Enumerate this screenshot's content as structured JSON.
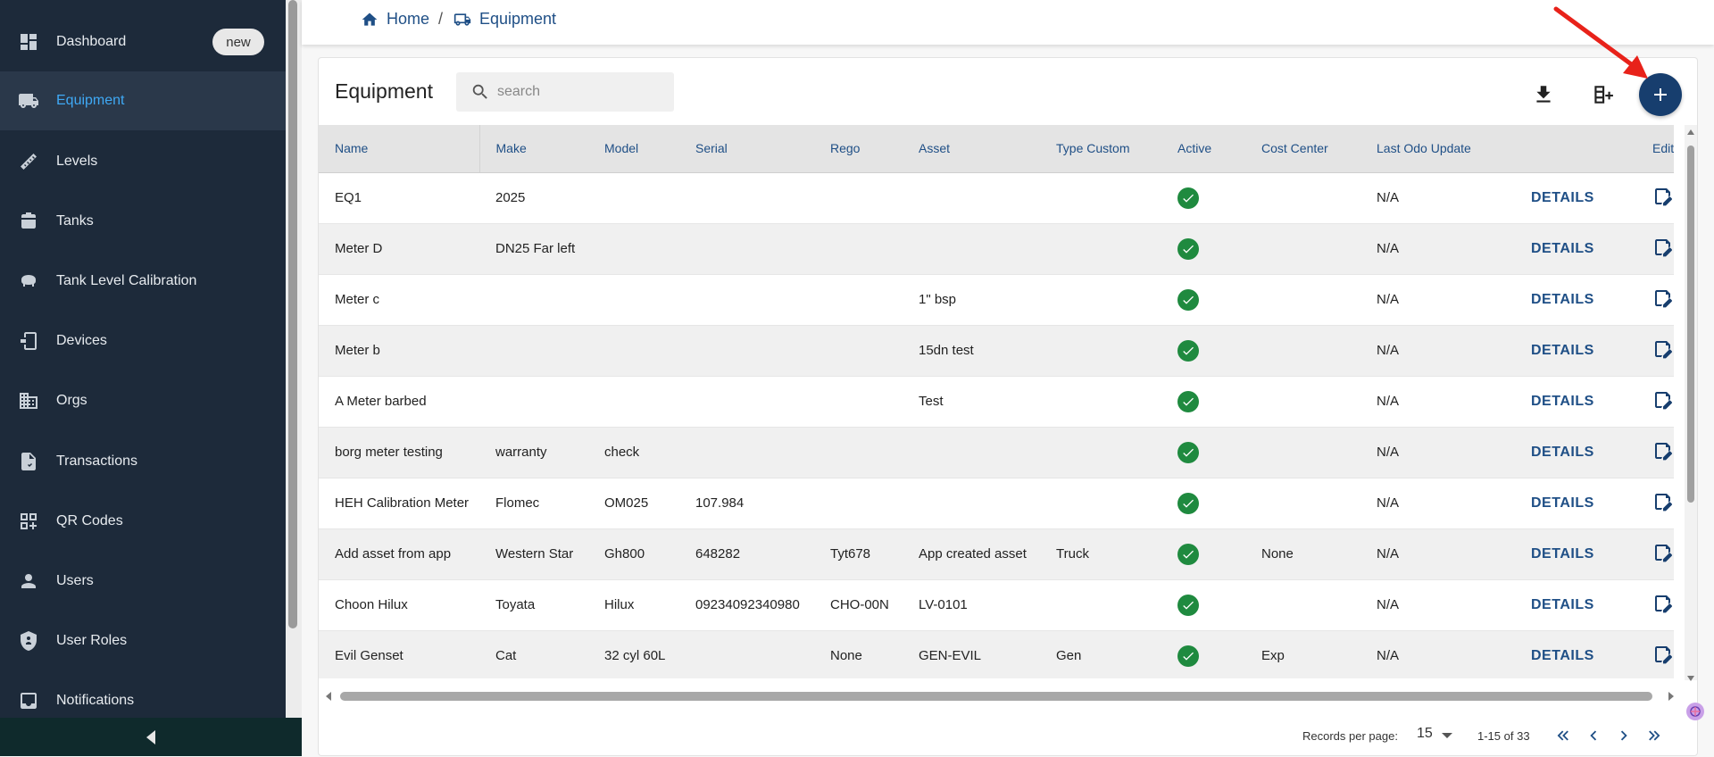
{
  "sidebar": {
    "items": [
      {
        "label": "Dashboard",
        "icon": "dashboard-icon",
        "badge": "new"
      },
      {
        "label": "Equipment",
        "icon": "truck-icon",
        "active": true
      },
      {
        "label": "Levels",
        "icon": "ruler-icon"
      },
      {
        "label": "Tanks",
        "icon": "tank-icon"
      },
      {
        "label": "Tank Level Calibration",
        "icon": "calibration-icon"
      },
      {
        "label": "Devices",
        "icon": "device-icon"
      },
      {
        "label": "Orgs",
        "icon": "building-icon"
      },
      {
        "label": "Transactions",
        "icon": "document-icon"
      },
      {
        "label": "QR Codes",
        "icon": "qr-code-icon"
      },
      {
        "label": "Users",
        "icon": "user-icon"
      },
      {
        "label": "User Roles",
        "icon": "shield-icon"
      },
      {
        "label": "Notifications",
        "icon": "inbox-icon"
      }
    ]
  },
  "breadcrumb": {
    "home": "Home",
    "separator": "/",
    "current": "Equipment"
  },
  "card": {
    "title": "Equipment",
    "search_placeholder": "search"
  },
  "table": {
    "columns": [
      "Name",
      "Make",
      "Model",
      "Serial",
      "Rego",
      "Asset",
      "Type Custom",
      "Active",
      "Cost Center",
      "Last Odo Update",
      "",
      "Edit"
    ],
    "details_label": "DETAILS",
    "rows": [
      {
        "name": "EQ1",
        "make": "2025",
        "model": "",
        "serial": "",
        "rego": "",
        "asset": "",
        "type_custom": "",
        "active": true,
        "cost_center": "",
        "last_odo": "N/A"
      },
      {
        "name": "Meter D",
        "make": "DN25 Far left",
        "model": "",
        "serial": "",
        "rego": "",
        "asset": "",
        "type_custom": "",
        "active": true,
        "cost_center": "",
        "last_odo": "N/A"
      },
      {
        "name": "Meter c",
        "make": "",
        "model": "",
        "serial": "",
        "rego": "",
        "asset": "1\" bsp",
        "type_custom": "",
        "active": true,
        "cost_center": "",
        "last_odo": "N/A"
      },
      {
        "name": "Meter b",
        "make": "",
        "model": "",
        "serial": "",
        "rego": "",
        "asset": "15dn test",
        "type_custom": "",
        "active": true,
        "cost_center": "",
        "last_odo": "N/A"
      },
      {
        "name": "A Meter barbed",
        "make": "",
        "model": "",
        "serial": "",
        "rego": "",
        "asset": "Test",
        "type_custom": "",
        "active": true,
        "cost_center": "",
        "last_odo": "N/A"
      },
      {
        "name": "borg meter testing",
        "make": "warranty",
        "model": "check",
        "serial": "",
        "rego": "",
        "asset": "",
        "type_custom": "",
        "active": true,
        "cost_center": "",
        "last_odo": "N/A"
      },
      {
        "name": "HEH Calibration Meter",
        "make": "Flomec",
        "model": "OM025",
        "serial": "107.984",
        "rego": "",
        "asset": "",
        "type_custom": "",
        "active": true,
        "cost_center": "",
        "last_odo": "N/A"
      },
      {
        "name": "Add asset from app",
        "make": "Western Star",
        "model": "Gh800",
        "serial": "648282",
        "rego": "Tyt678",
        "asset": "App created asset",
        "type_custom": "Truck",
        "active": true,
        "cost_center": "None",
        "last_odo": "N/A"
      },
      {
        "name": "Choon Hilux",
        "make": "Toyata",
        "model": "Hilux",
        "serial": "09234092340980",
        "rego": "CHO-00N",
        "asset": "LV-0101",
        "type_custom": "",
        "active": true,
        "cost_center": "",
        "last_odo": "N/A"
      },
      {
        "name": "Evil Genset",
        "make": "Cat",
        "model": "32 cyl 60L",
        "serial": "",
        "rego": "None",
        "asset": "GEN-EVIL",
        "type_custom": "Gen",
        "active": true,
        "cost_center": "Exp",
        "last_odo": "N/A"
      }
    ]
  },
  "pagination": {
    "records_per_page_label": "Records per page:",
    "records_per_page": "15",
    "range": "1-15 of 33"
  },
  "colors": {
    "sidebar_bg": "#1d2a3a",
    "accent": "#1f4f86",
    "active_nav": "#3fa9f5",
    "active_check": "#1f8a3f",
    "annotation_arrow": "#e8221a"
  }
}
